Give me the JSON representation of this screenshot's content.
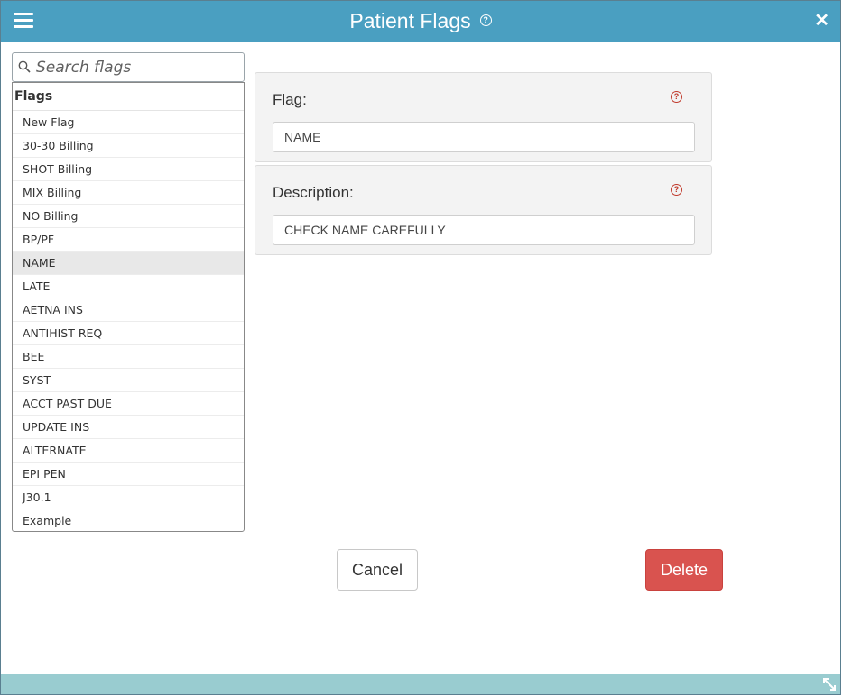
{
  "window": {
    "title": "Patient Flags",
    "help_glyph": "?",
    "close_glyph": "✕"
  },
  "search": {
    "placeholder": "Search flags",
    "value": ""
  },
  "flags": {
    "header": "Flags",
    "items": [
      {
        "label": "New Flag"
      },
      {
        "label": "30-30 Billing"
      },
      {
        "label": "SHOT Billing"
      },
      {
        "label": "MIX Billing"
      },
      {
        "label": "NO Billing"
      },
      {
        "label": "BP/PF"
      },
      {
        "label": "NAME"
      },
      {
        "label": "LATE"
      },
      {
        "label": "AETNA INS"
      },
      {
        "label": "ANTIHIST REQ"
      },
      {
        "label": "BEE"
      },
      {
        "label": "SYST"
      },
      {
        "label": "ACCT PAST DUE"
      },
      {
        "label": "UPDATE INS"
      },
      {
        "label": "ALTERNATE"
      },
      {
        "label": "EPI PEN"
      },
      {
        "label": "J30.1"
      },
      {
        "label": "Example"
      }
    ],
    "selected": "NAME"
  },
  "form": {
    "flag_label": "Flag:",
    "flag_value": "NAME",
    "description_label": "Description:",
    "description_value": "CHECK NAME CAREFULLY",
    "help_glyph": "?"
  },
  "buttons": {
    "cancel": "Cancel",
    "delete": "Delete"
  },
  "colors": {
    "titlebar": "#4a9fc1",
    "statusbar": "#99ccd0",
    "delete": "#d9534f",
    "help_red": "#c0392b"
  }
}
